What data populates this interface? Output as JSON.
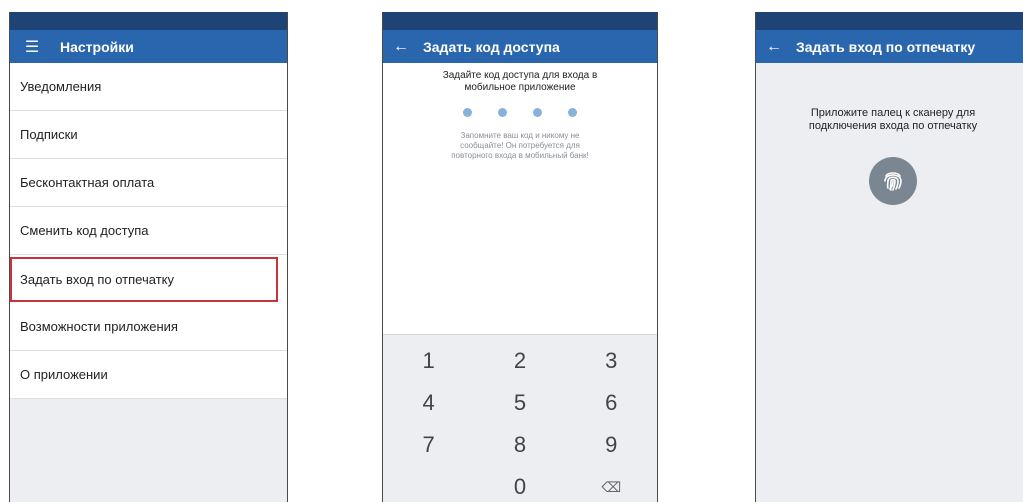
{
  "settings": {
    "title": "Настройки",
    "items": [
      {
        "label": "Уведомления"
      },
      {
        "label": "Подписки"
      },
      {
        "label": "Бесконтактная оплата"
      },
      {
        "label": "Сменить код доступа"
      },
      {
        "label": "Задать вход по отпечатку"
      },
      {
        "label": "Возможности приложения"
      },
      {
        "label": "О приложении"
      }
    ],
    "highlight_color": "#c8343c"
  },
  "pincode": {
    "title": "Задать код доступа",
    "prompt_line1": "Задайте код доступа для входа в",
    "prompt_line2": "мобильное приложение",
    "note_line1": "Запомните ваш код и никому не",
    "note_line2": "сообщайте! Он потребуется для",
    "note_line3": "повторного входа в мобильный банк!",
    "keys": [
      "1",
      "2",
      "3",
      "4",
      "5",
      "6",
      "7",
      "8",
      "9",
      "0"
    ],
    "backspace_icon": "backspace-icon"
  },
  "fingerprint": {
    "title": "Задать вход по отпечатку",
    "text_line1": "Приложите палец к сканеру для",
    "text_line2": "подключения входа по отпечатку",
    "icon": "fingerprint-icon"
  },
  "colors": {
    "status_bar": "#1e4476",
    "app_bar": "#2a66ad",
    "pin_dot": "#8ab0dc"
  }
}
